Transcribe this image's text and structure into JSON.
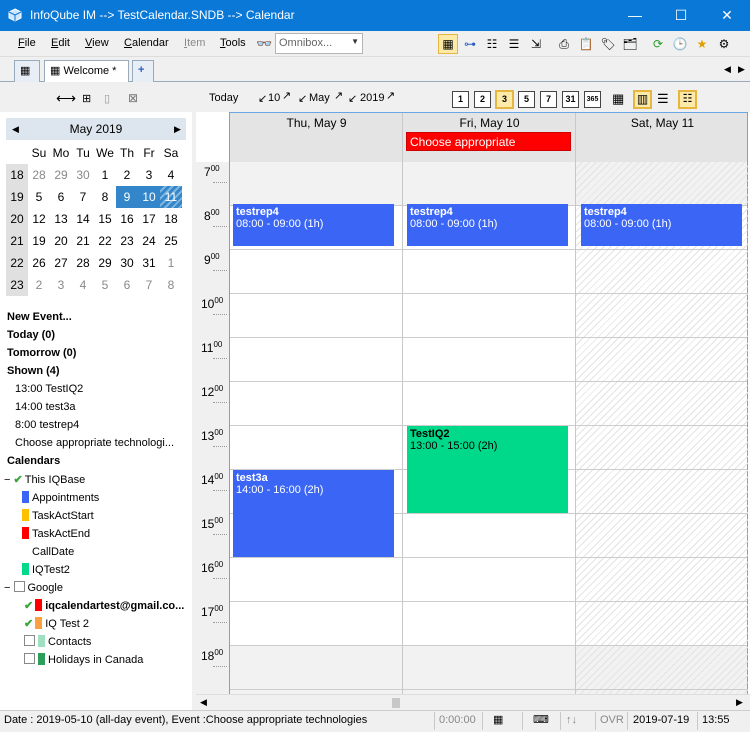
{
  "window": {
    "title": "InfoQube IM  --> TestCalendar.SNDB --> Calendar",
    "min": "—",
    "max": "☐",
    "close": "✕"
  },
  "menu": [
    "File",
    "Edit",
    "View",
    "Calendar",
    "Item",
    "Tools"
  ],
  "omnibox": {
    "placeholder": "Omnibox..."
  },
  "tabs": {
    "welcome": "Welcome *",
    "add": "+"
  },
  "nav": {
    "today": "Today",
    "day": "10",
    "month": "May",
    "year": "2019"
  },
  "view_buttons": [
    "1",
    "2",
    "3",
    "5",
    "7",
    "31",
    "365"
  ],
  "minical": {
    "month": "May 2019",
    "dow": [
      "Su",
      "Mo",
      "Tu",
      "We",
      "Th",
      "Fr",
      "Sa"
    ],
    "weeks": [
      {
        "wk": "18",
        "days": [
          "28",
          "29",
          "30",
          "1",
          "2",
          "3",
          "4"
        ]
      },
      {
        "wk": "19",
        "days": [
          "5",
          "6",
          "7",
          "8",
          "9",
          "10",
          "11"
        ]
      },
      {
        "wk": "20",
        "days": [
          "12",
          "13",
          "14",
          "15",
          "16",
          "17",
          "18"
        ]
      },
      {
        "wk": "21",
        "days": [
          "19",
          "20",
          "21",
          "22",
          "23",
          "24",
          "25"
        ]
      },
      {
        "wk": "22",
        "days": [
          "26",
          "27",
          "28",
          "29",
          "30",
          "31",
          "1"
        ]
      },
      {
        "wk": "23",
        "days": [
          "2",
          "3",
          "4",
          "5",
          "6",
          "7",
          "8"
        ]
      }
    ]
  },
  "tree": {
    "new_event": "New Event...",
    "today": "Today (0)",
    "tomorrow": "Tomorrow (0)",
    "shown": "Shown (4)",
    "shown_items": [
      "13:00 TestIQ2",
      "14:00 test3a",
      "8:00 testrep4",
      "Choose appropriate technologi..."
    ],
    "calendars": "Calendars",
    "this_iqbase": "This IQBase",
    "iq_cals": [
      {
        "name": "Appointments",
        "color": "#3b66f5"
      },
      {
        "name": "TaskActStart",
        "color": "#ffc000"
      },
      {
        "name": "TaskActEnd",
        "color": "#ff0000"
      },
      {
        "name": "CallDate",
        "color": "#ffffff"
      },
      {
        "name": "IQTest2",
        "color": "#00d98a"
      }
    ],
    "google": "Google",
    "google_cals": [
      {
        "name": "iqcalendartest@gmail.co...",
        "color": "#ff0000",
        "checked": true,
        "bold": true
      },
      {
        "name": "IQ Test 2",
        "color": "#ffa040",
        "checked": true,
        "bold": false
      },
      {
        "name": "Contacts",
        "color": "#9fe0c0",
        "checked": false,
        "bold": false
      },
      {
        "name": "Holidays in Canada",
        "color": "#2e9e5b",
        "checked": false,
        "bold": false
      }
    ]
  },
  "columns": [
    "Thu, May 9",
    "Fri, May 10",
    "Sat, May 11"
  ],
  "allday_event": "Choose appropriate",
  "hours": [
    "7",
    "8",
    "9",
    "10",
    "11",
    "12",
    "13",
    "14",
    "15",
    "16",
    "17",
    "18"
  ],
  "hour_suffix": "00",
  "events": [
    {
      "name": "testrep4",
      "time": "08:00 - 09:00 (1h)"
    },
    {
      "name": "testrep4",
      "time": "08:00 - 09:00 (1h)"
    },
    {
      "name": "testrep4",
      "time": "08:00 - 09:00 (1h)"
    },
    {
      "name": "TestIQ2",
      "time": "13:00 - 15:00 (2h)"
    },
    {
      "name": "test3a",
      "time": "14:00 - 16:00 (2h)"
    }
  ],
  "status": {
    "info": "Date : 2019-05-10 (all-day event), Event :Choose appropriate technologies",
    "timer": "0:00:00",
    "ovr": "OVR",
    "date": "2019-07-19",
    "time": "13:55"
  }
}
